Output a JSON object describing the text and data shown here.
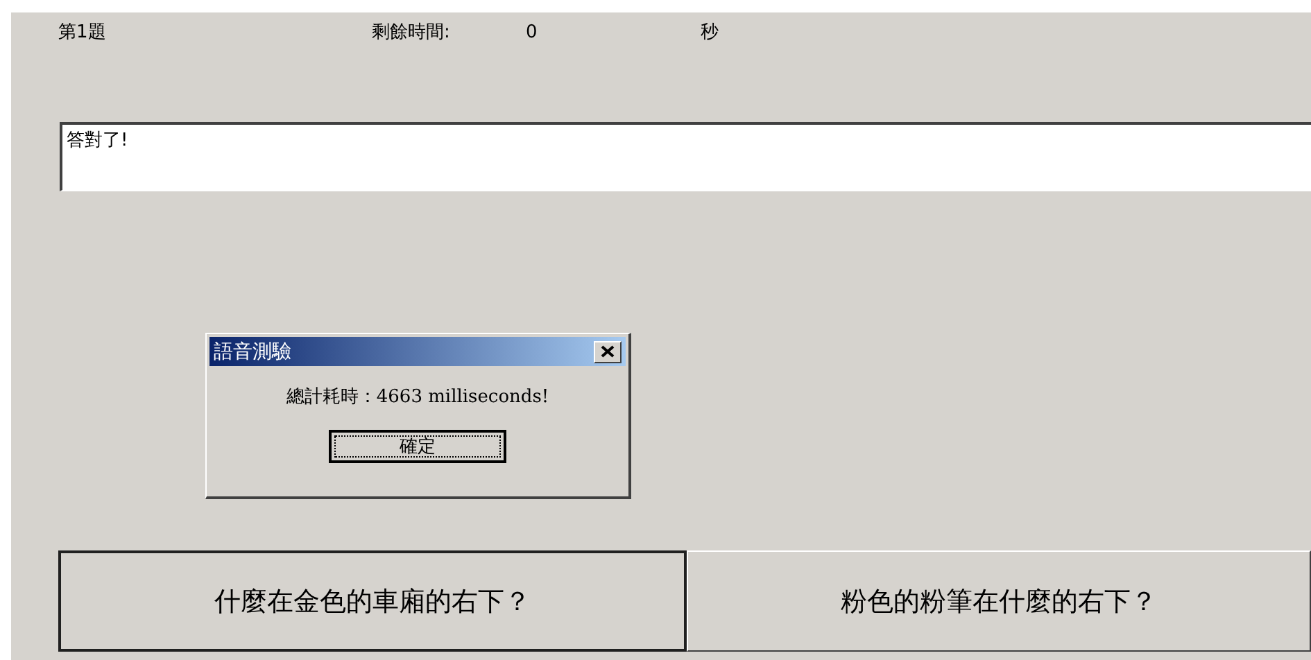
{
  "header": {
    "question": "第1題",
    "time_label": "剩餘時間:",
    "time_value": "0",
    "time_unit": "秒"
  },
  "answer_box": {
    "value": "答對了!"
  },
  "dialog": {
    "title": "語音測驗",
    "message": "總計耗時：4663 milliseconds!",
    "ok": "確定"
  },
  "choices": [
    {
      "label": "什麼在金色的車廂的右下？",
      "pressed": true
    },
    {
      "label": "粉色的粉筆在什麼的右下？",
      "pressed": false
    }
  ]
}
